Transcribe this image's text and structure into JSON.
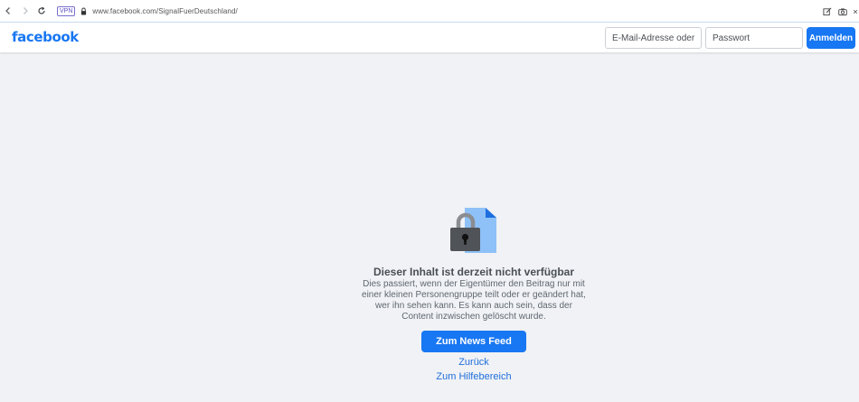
{
  "browser": {
    "vpn_label": "VPN",
    "url": "www.facebook.com/SignalFuerDeutschland/",
    "icons": [
      "back-icon",
      "forward-icon",
      "reload-icon",
      "lock-icon",
      "edit-icon",
      "camera-icon",
      "close-icon"
    ]
  },
  "header": {
    "logo": "facebook",
    "email_placeholder": "E-Mail-Adresse oder Ha",
    "password_placeholder": "Passwort",
    "login_label": "Anmelden"
  },
  "message": {
    "title": "Dieser Inhalt ist derzeit nicht verfügbar",
    "description": "Dies passiert, wenn der Eigentümer den Beitrag nur mit einer kleinen Personengruppe teilt oder er geändert hat, wer ihn sehen kann. Es kann auch sein, dass der Content inzwischen gelöscht wurde.",
    "news_feed_button": "Zum News Feed",
    "back_link": "Zurück",
    "help_link": "Zum Hilfebereich"
  },
  "colors": {
    "brand": "#1877f2",
    "background": "#f0f2f5",
    "link": "#216fdb"
  }
}
